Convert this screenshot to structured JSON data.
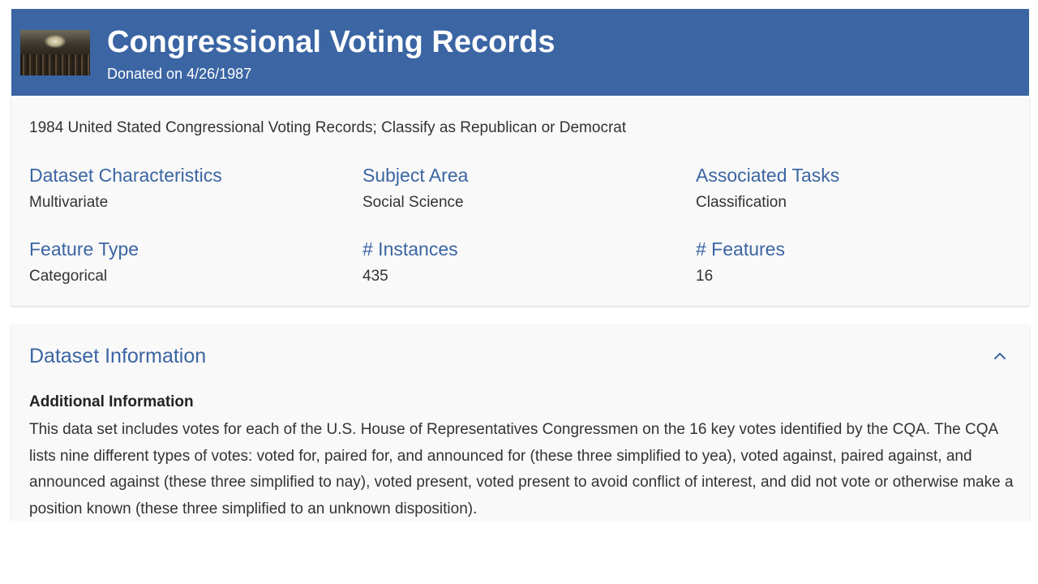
{
  "header": {
    "title": "Congressional Voting Records",
    "donated": "Donated on 4/26/1987",
    "accent_color": "#3b65a3"
  },
  "summary": "1984 United Stated Congressional Voting Records; Classify as Republican or Democrat",
  "characteristics": [
    {
      "label": "Dataset Characteristics",
      "value": "Multivariate"
    },
    {
      "label": "Subject Area",
      "value": "Social Science"
    },
    {
      "label": "Associated Tasks",
      "value": "Classification"
    },
    {
      "label": "Feature Type",
      "value": "Categorical"
    },
    {
      "label": "# Instances",
      "value": "435"
    },
    {
      "label": "# Features",
      "value": "16"
    }
  ],
  "dataset_information": {
    "title": "Dataset Information",
    "toggle_icon": "chevron-up-icon",
    "additional_information_heading": "Additional Information",
    "additional_information_text": "This data set includes votes for each of the U.S. House of Representatives Congressmen on the 16 key votes identified by the CQA.  The CQA lists nine different types of votes: voted for, paired for, and announced for (these three simplified to yea), voted against, paired against, and announced against (these three simplified to nay), voted present, voted present to avoid conflict of interest, and did not vote or otherwise make a position known (these three simplified to an unknown disposition)."
  }
}
